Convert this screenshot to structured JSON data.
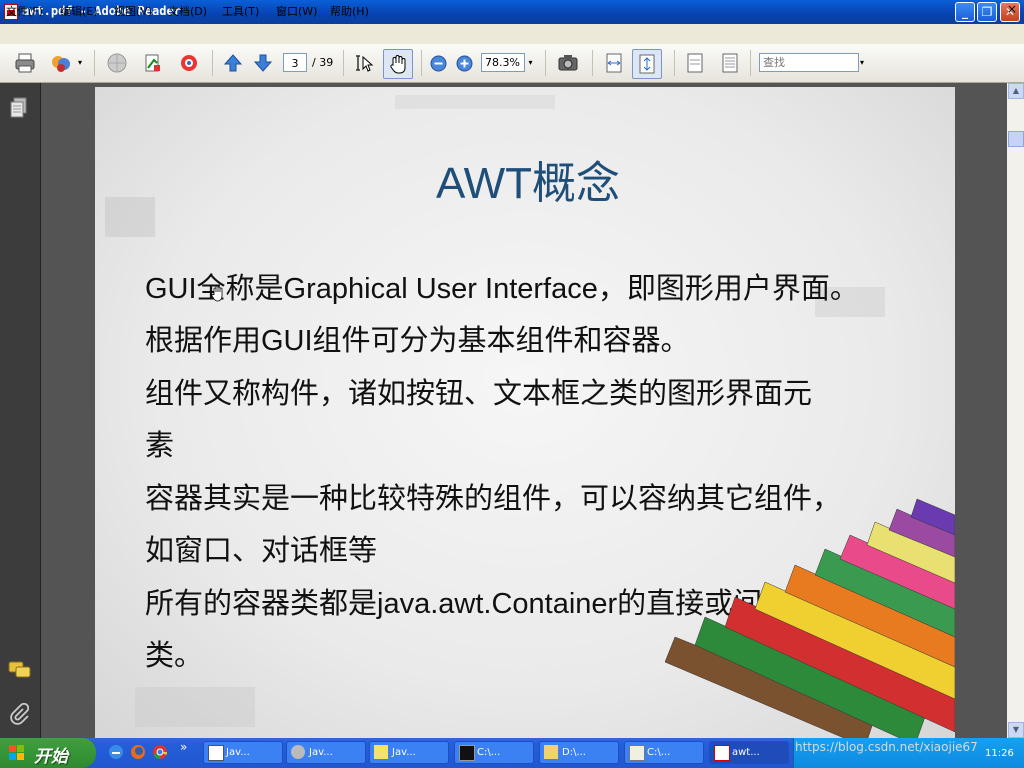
{
  "window": {
    "title": "awt.pdf - Adobe Reader"
  },
  "menu": [
    {
      "label": "文件(F)"
    },
    {
      "label": "编辑(E)"
    },
    {
      "label": "视图(V)"
    },
    {
      "label": "文档(D)"
    },
    {
      "label": "工具(T)"
    },
    {
      "label": "窗口(W)"
    },
    {
      "label": "帮助(H)"
    }
  ],
  "menu_close": "×",
  "toolbar": {
    "page_current": "3",
    "page_total": "/ 39",
    "zoom": "78.3%",
    "search_placeholder": "查找"
  },
  "slide": {
    "title": "AWT概念",
    "lines": [
      "GUI全称是Graphical User Interface，即图形用户界面。",
      "根据作用GUI组件可分为基本组件和容器。",
      "组件又称构件，诸如按钮、文本框之类的图形界面元",
      "素",
      "容器其实是一种比较特殊的组件，可以容纳其它组件，",
      "如窗口、对话框等",
      "所有的容器类都是java.awt.Container的直接或间接子",
      "类。"
    ]
  },
  "taskbar": {
    "start_label": "开始",
    "tasks": [
      {
        "label": "Jav..."
      },
      {
        "label": "Jav..."
      },
      {
        "label": "Jav..."
      },
      {
        "label": "C:\\..."
      },
      {
        "label": "D:\\..."
      },
      {
        "label": "C:\\..."
      },
      {
        "label": "awt..."
      }
    ],
    "watermark": "https://blog.csdn.net/xiaojie67",
    "clock": "11:26"
  },
  "colors": {
    "title_blue": "#1f4e79",
    "xp_taskbar": "#245ed8",
    "start_green": "#3ea040"
  }
}
